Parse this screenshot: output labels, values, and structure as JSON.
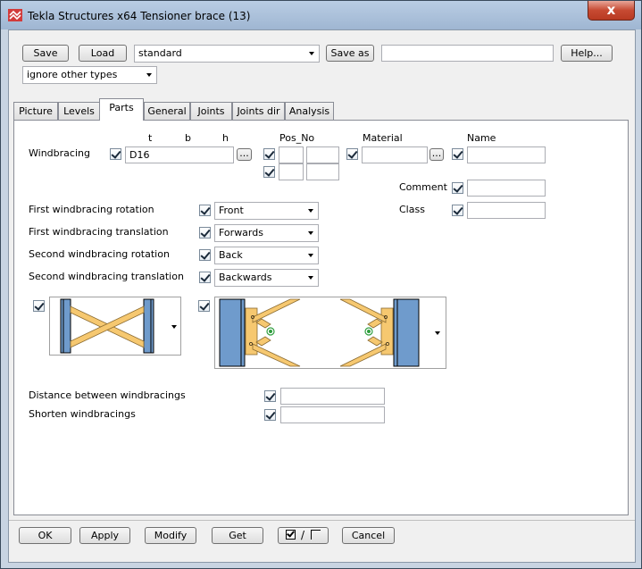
{
  "window": {
    "title": "Tekla Structures x64  Tensioner brace (13)",
    "close_glyph": "x"
  },
  "toolbar": {
    "save": "Save",
    "load": "Load",
    "preset": "standard",
    "save_as": "Save as",
    "save_as_value": "",
    "help": "Help...",
    "filter": "ignore other types"
  },
  "tabs": [
    {
      "label": "Picture"
    },
    {
      "label": "Levels"
    },
    {
      "label": "Parts"
    },
    {
      "label": "General"
    },
    {
      "label": "Joints"
    },
    {
      "label": "Joints dir"
    },
    {
      "label": "Analysis"
    }
  ],
  "active_tab": "Parts",
  "parts": {
    "col_t": "t",
    "col_b": "b",
    "col_h": "h",
    "col_pos_no": "Pos_No",
    "col_material": "Material",
    "col_name": "Name",
    "windbracing_label": "Windbracing",
    "profile_value": "D16",
    "browse": "...",
    "pos_prefix_1": "",
    "pos_start_1": "",
    "pos_prefix_2": "",
    "pos_start_2": "",
    "material_value": "",
    "name_value": "",
    "comment_label": "Comment",
    "comment_value": "",
    "class_label": "Class",
    "class_value": ""
  },
  "options": [
    {
      "label": "First windbracing rotation",
      "value": "Front"
    },
    {
      "label": "First windbracing translation",
      "value": "Forwards"
    },
    {
      "label": "Second windbracing rotation",
      "value": "Back"
    },
    {
      "label": "Second windbracing translation",
      "value": "Backwards"
    }
  ],
  "distances": {
    "distance_label": "Distance between windbracings",
    "distance_value": "",
    "shorten_label": "Shorten windbracings",
    "shorten_value": ""
  },
  "footer": {
    "ok": "OK",
    "apply": "Apply",
    "modify": "Modify",
    "get": "Get",
    "toggle_separator": "/",
    "cancel": "Cancel"
  },
  "colors": {
    "column": "#6f9bcc",
    "brace": "#f6c870",
    "plate": "#f6c870",
    "bolt": "#2e9e3e"
  }
}
